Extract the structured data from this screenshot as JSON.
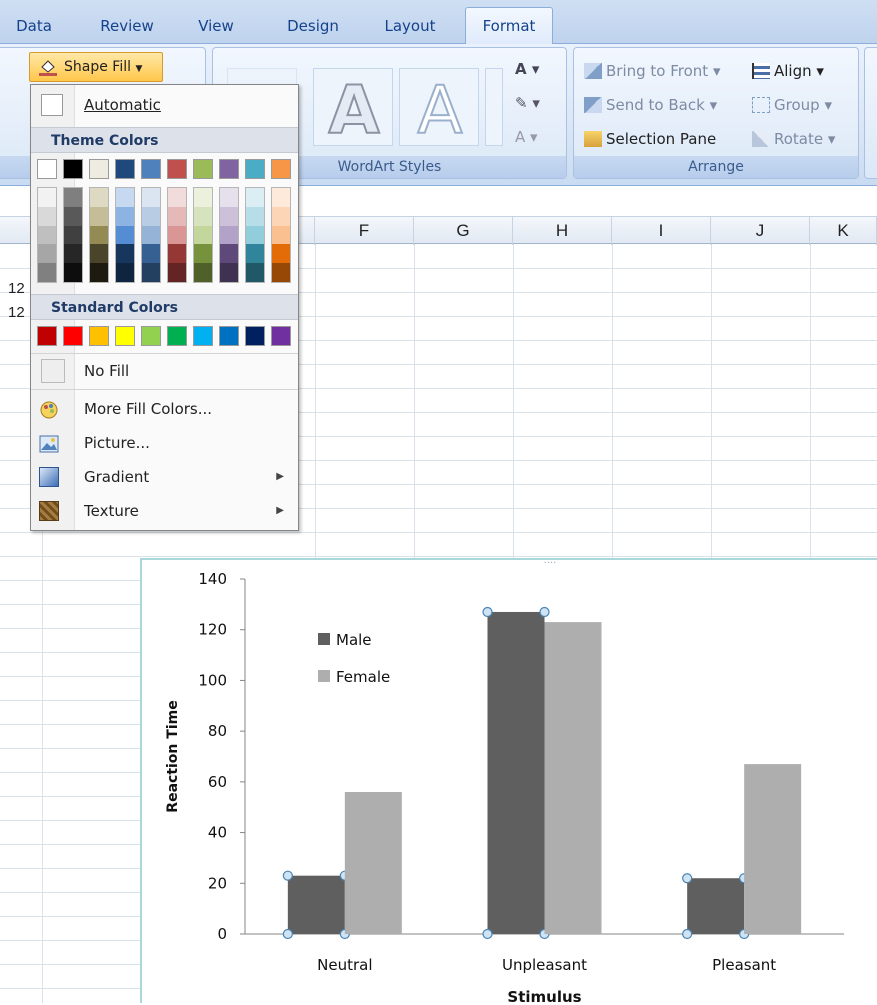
{
  "ribbon_tabs": [
    {
      "label": "Data"
    },
    {
      "label": "Review"
    },
    {
      "label": "View"
    },
    {
      "label": "Design"
    },
    {
      "label": "Layout"
    },
    {
      "label": "Format",
      "active": true
    }
  ],
  "shape_fill_button": "Shape Fill",
  "wordart": {
    "group_label": "WordArt Styles"
  },
  "arrange": {
    "group_label": "Arrange",
    "bring_to_front": "Bring to Front",
    "align": "Align",
    "send_to_back": "Send to Back",
    "group": "Group",
    "selection_pane": "Selection Pane",
    "rotate": "Rotate"
  },
  "fill_menu": {
    "automatic": "Automatic",
    "theme_colors_title": "Theme Colors",
    "theme_colors": [
      "#ffffff",
      "#000000",
      "#eeece1",
      "#1f497d",
      "#4f81bd",
      "#c0504d",
      "#9bbb59",
      "#8064a2",
      "#4bacc6",
      "#f79646"
    ],
    "theme_shades": [
      [
        "#f2f2f2",
        "#d9d9d9",
        "#bfbfbf",
        "#a6a6a6",
        "#808080"
      ],
      [
        "#7f7f7f",
        "#595959",
        "#404040",
        "#262626",
        "#0d0d0d"
      ],
      [
        "#ddd9c3",
        "#c4bd97",
        "#948a54",
        "#4a452a",
        "#1d1b10"
      ],
      [
        "#c6d9f0",
        "#8db3e2",
        "#548dd4",
        "#17365d",
        "#0f243e"
      ],
      [
        "#dbe5f1",
        "#b8cce4",
        "#95b3d7",
        "#366092",
        "#244061"
      ],
      [
        "#f2dcdb",
        "#e5b9b7",
        "#d99694",
        "#953734",
        "#632423"
      ],
      [
        "#ebf1dd",
        "#d7e3bc",
        "#c3d69b",
        "#76923c",
        "#4f6128"
      ],
      [
        "#e5e0ec",
        "#ccc1d9",
        "#b2a2c7",
        "#5f497a",
        "#3f3151"
      ],
      [
        "#dbeef3",
        "#b7dde8",
        "#92cddc",
        "#31859b",
        "#205867"
      ],
      [
        "#fdeada",
        "#fbd5b5",
        "#fac08f",
        "#e36c09",
        "#974806"
      ]
    ],
    "standard_colors_title": "Standard Colors",
    "standard_colors": [
      "#c00000",
      "#ff0000",
      "#ffc000",
      "#ffff00",
      "#92d050",
      "#00b050",
      "#00b0f0",
      "#0070c0",
      "#002060",
      "#7030a0"
    ],
    "no_fill": "No Fill",
    "more_fill_colors": "More Fill Colors...",
    "picture": "Picture...",
    "gradient": "Gradient",
    "texture": "Texture"
  },
  "sheet": {
    "columns": [
      "F",
      "G",
      "H",
      "I",
      "J",
      "K"
    ],
    "visible_cells": [
      "12",
      "12"
    ]
  },
  "chart_data": {
    "type": "bar",
    "categories": [
      "Neutral",
      "Unpleasant",
      "Pleasant"
    ],
    "series": [
      {
        "name": "Male",
        "values": [
          23,
          127,
          22
        ],
        "color": "#5f5f5f"
      },
      {
        "name": "Female",
        "values": [
          56,
          123,
          67
        ],
        "color": "#aeaeae"
      }
    ],
    "xlabel": "Stimulus",
    "ylabel": "Reaction Time",
    "ylim": [
      0,
      140
    ],
    "yticks": [
      0,
      20,
      40,
      60,
      80,
      100,
      120,
      140
    ],
    "legend_position": "top-left",
    "grid": false,
    "selected_series": "Male"
  }
}
